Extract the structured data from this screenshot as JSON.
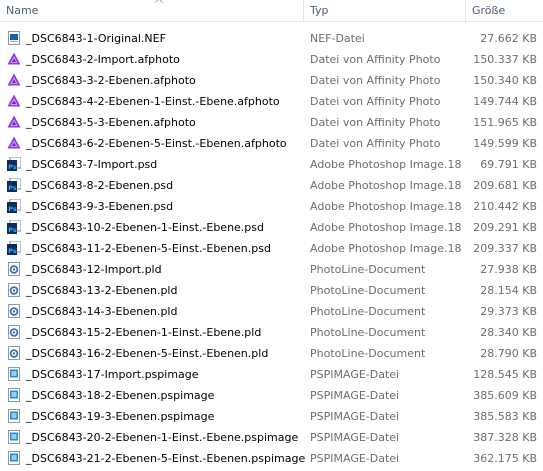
{
  "columns": {
    "name": "Name",
    "type": "Typ",
    "size": "Größe"
  },
  "files": [
    {
      "name": "_DSC6843-1-Original.NEF",
      "type": "NEF-Datei",
      "size": "27.662 KB",
      "icon": "nef-file-icon"
    },
    {
      "name": "_DSC6843-2-Import.afphoto",
      "type": "Datei von Affinity Photo",
      "size": "150.337 KB",
      "icon": "affinity-photo-icon"
    },
    {
      "name": "_DSC6843-3-2-Ebenen.afphoto",
      "type": "Datei von Affinity Photo",
      "size": "150.340 KB",
      "icon": "affinity-photo-icon"
    },
    {
      "name": "_DSC6843-4-2-Ebenen-1-Einst.-Ebene.afphoto",
      "type": "Datei von Affinity Photo",
      "size": "149.744 KB",
      "icon": "affinity-photo-icon"
    },
    {
      "name": "_DSC6843-5-3-Ebenen.afphoto",
      "type": "Datei von Affinity Photo",
      "size": "151.965 KB",
      "icon": "affinity-photo-icon"
    },
    {
      "name": "_DSC6843-6-2-Ebenen-5-Einst.-Ebenen.afphoto",
      "type": "Datei von Affinity Photo",
      "size": "149.599 KB",
      "icon": "affinity-photo-icon"
    },
    {
      "name": "_DSC6843-7-Import.psd",
      "type": "Adobe Photoshop Image.18",
      "size": "69.791 KB",
      "icon": "photoshop-icon"
    },
    {
      "name": "_DSC6843-8-2-Ebenen.psd",
      "type": "Adobe Photoshop Image.18",
      "size": "209.681 KB",
      "icon": "photoshop-icon"
    },
    {
      "name": "_DSC6843-9-3-Ebenen.psd",
      "type": "Adobe Photoshop Image.18",
      "size": "210.442 KB",
      "icon": "photoshop-icon"
    },
    {
      "name": "_DSC6843-10-2-Ebenen-1-Einst.-Ebene.psd",
      "type": "Adobe Photoshop Image.18",
      "size": "209.291 KB",
      "icon": "photoshop-icon"
    },
    {
      "name": "_DSC6843-11-2-Ebenen-5-Einst.-Ebenen.psd",
      "type": "Adobe Photoshop Image.18",
      "size": "209.337 KB",
      "icon": "photoshop-icon"
    },
    {
      "name": "_DSC6843-12-Import.pld",
      "type": "PhotoLine-Document",
      "size": "27.938 KB",
      "icon": "photoline-icon"
    },
    {
      "name": "_DSC6843-13-2-Ebenen.pld",
      "type": "PhotoLine-Document",
      "size": "28.154 KB",
      "icon": "photoline-icon"
    },
    {
      "name": "_DSC6843-14-3-Ebenen.pld",
      "type": "PhotoLine-Document",
      "size": "29.373 KB",
      "icon": "photoline-icon"
    },
    {
      "name": "_DSC6843-15-2-Ebenen-1-Einst.-Ebene.pld",
      "type": "PhotoLine-Document",
      "size": "28.340 KB",
      "icon": "photoline-icon"
    },
    {
      "name": "_DSC6843-16-2-Ebenen-5-Einst.-Ebenen.pld",
      "type": "PhotoLine-Document",
      "size": "28.790 KB",
      "icon": "photoline-icon"
    },
    {
      "name": "_DSC6843-17-Import.pspimage",
      "type": "PSPIMAGE-Datei",
      "size": "128.545 KB",
      "icon": "pspimage-icon"
    },
    {
      "name": "_DSC6843-18-2-Ebenen.pspimage",
      "type": "PSPIMAGE-Datei",
      "size": "385.609 KB",
      "icon": "pspimage-icon"
    },
    {
      "name": "_DSC6843-19-3-Ebenen.pspimage",
      "type": "PSPIMAGE-Datei",
      "size": "385.583 KB",
      "icon": "pspimage-icon"
    },
    {
      "name": "_DSC6843-20-2-Ebenen-1-Einst.-Ebene.pspimage",
      "type": "PSPIMAGE-Datei",
      "size": "387.328 KB",
      "icon": "pspimage-icon"
    },
    {
      "name": "_DSC6843-21-2-Ebenen-5-Einst.-Ebenen.pspimage",
      "type": "PSPIMAGE-Datei",
      "size": "362.175 KB",
      "icon": "pspimage-icon"
    }
  ]
}
